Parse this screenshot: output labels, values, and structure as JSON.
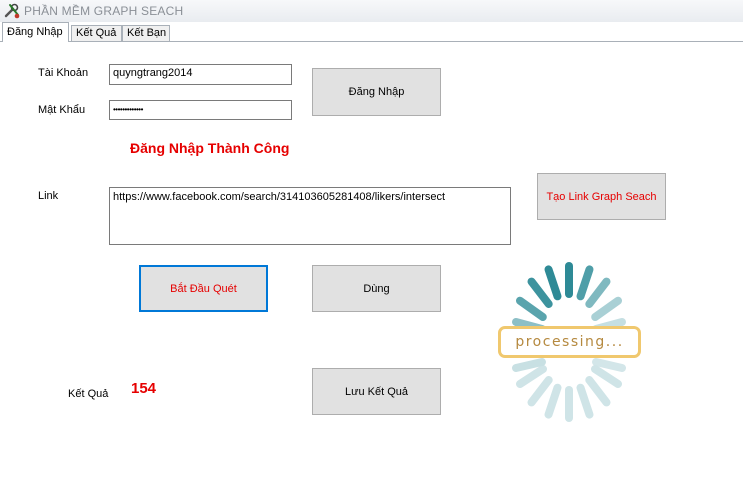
{
  "window": {
    "title": "PHẦN MỀM GRAPH SEACH",
    "icon": "tools-icon"
  },
  "tabs": [
    {
      "label": "Đăng Nhập",
      "active": true
    },
    {
      "label": "Kết Quả",
      "active": false
    },
    {
      "label": "Kết Bạn",
      "active": false
    }
  ],
  "login": {
    "account_label": "Tài Khoản",
    "account_value": "quyngtrang2014",
    "password_label": "Mật Khẩu",
    "password_value": "•••••••••••••",
    "login_button": "Đăng Nhập",
    "status_message": "Đăng Nhập Thành Công"
  },
  "link": {
    "label": "Link",
    "value": "https://www.facebook.com/search/314103605281408/likers/intersect",
    "create_button": "Tạo Link Graph Seach"
  },
  "actions": {
    "start_button": "Bắt Đầu Quét",
    "stop_button": "Dùng",
    "save_button": "Lưu Kết Quả"
  },
  "result": {
    "label": "Kết Quả",
    "count": "154"
  },
  "processing": {
    "text": "processing...",
    "icon": "spinner-icon"
  },
  "colors": {
    "accent_red": "#e60000",
    "focus_blue": "#0078d7",
    "spinner_teal": "#2e8a96",
    "badge_gold": "#f0c86e"
  }
}
